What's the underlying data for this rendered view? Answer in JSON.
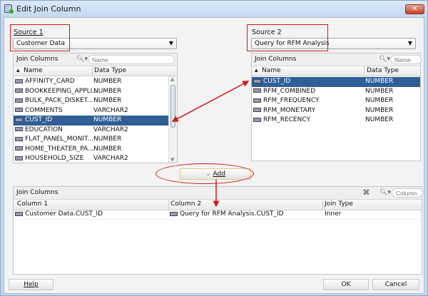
{
  "window": {
    "title": "Edit Join Column",
    "close": "✕"
  },
  "source1": {
    "label": "Source 1",
    "value": "Customer Data",
    "table_title": "Join Columns",
    "search_placeholder": "Name",
    "col_name": "Name",
    "col_type": "Data Type",
    "rows": [
      {
        "name": "AFFINITY_CARD",
        "type": "NUMBER"
      },
      {
        "name": "BOOKKEEPING_APPLI...",
        "type": "NUMBER"
      },
      {
        "name": "BULK_PACK_DISKET...",
        "type": "NUMBER"
      },
      {
        "name": "COMMENTS",
        "type": "VARCHAR2"
      },
      {
        "name": "CUST_ID",
        "type": "NUMBER",
        "selected": true
      },
      {
        "name": "EDUCATION",
        "type": "VARCHAR2"
      },
      {
        "name": "FLAT_PANEL_MONIT...",
        "type": "NUMBER"
      },
      {
        "name": "HOME_THEATER_PA...",
        "type": "NUMBER"
      },
      {
        "name": "HOUSEHOLD_SIZE",
        "type": "VARCHAR2"
      }
    ]
  },
  "source2": {
    "label": "Source 2",
    "value": "Query for RFM Analysis",
    "table_title": "Join Columns",
    "search_placeholder": "Name",
    "col_name": "Name",
    "col_type": "Data Type",
    "rows": [
      {
        "name": "CUST_ID",
        "type": "NUMBER",
        "selected": true
      },
      {
        "name": "RFM_COMBINED",
        "type": "NUMBER"
      },
      {
        "name": "RFM_FREQUENCY",
        "type": "NUMBER"
      },
      {
        "name": "RFM_MONETARY",
        "type": "NUMBER"
      },
      {
        "name": "RFM_RECENCY",
        "type": "NUMBER"
      }
    ]
  },
  "add_button": "Add",
  "joins": {
    "title": "Join Columns",
    "search_placeholder": "Column",
    "col1": "Column 1",
    "col2": "Column 2",
    "col3": "Join Type",
    "rows": [
      {
        "c1": "Customer Data.CUST_ID",
        "c2": "Query for RFM Analysis.CUST_ID",
        "c3": "Inner"
      }
    ]
  },
  "footer": {
    "help": "Help",
    "ok": "OK",
    "cancel": "Cancel"
  },
  "colors": {
    "selection": "#2f5f96",
    "annotation": "#d01a1a"
  }
}
